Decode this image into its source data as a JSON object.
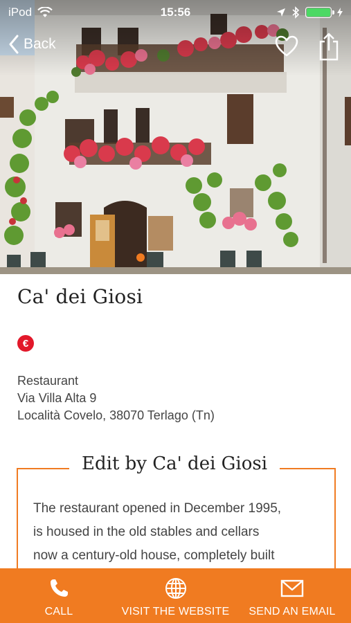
{
  "status_bar": {
    "carrier": "iPod",
    "time": "15:56",
    "icons": [
      "wifi-icon",
      "location-arrow-icon",
      "bluetooth-icon",
      "battery-icon",
      "charging-icon"
    ]
  },
  "nav": {
    "back_label": "Back",
    "favorite_icon": "heart-icon",
    "share_icon": "share-icon"
  },
  "place": {
    "name": "Ca' dei Giosi",
    "price_symbol": "€",
    "category": "Restaurant",
    "address_line1": "Via Villa Alta 9",
    "address_line2": "Località Covelo, 38070 Terlago (Tn)"
  },
  "edit": {
    "title": "Edit by Ca' dei Giosi",
    "lines": [
      "The restaurant opened in December 1995,",
      "is housed in the old stables and cellars",
      "now a century-old house, completely built"
    ]
  },
  "actions": {
    "call": "CALL",
    "website": "VISIT THE WEBSITE",
    "email": "SEND AN EMAIL"
  },
  "colors": {
    "accent": "#f07b21",
    "price_badge": "#e2182a",
    "battery": "#4cd964"
  }
}
